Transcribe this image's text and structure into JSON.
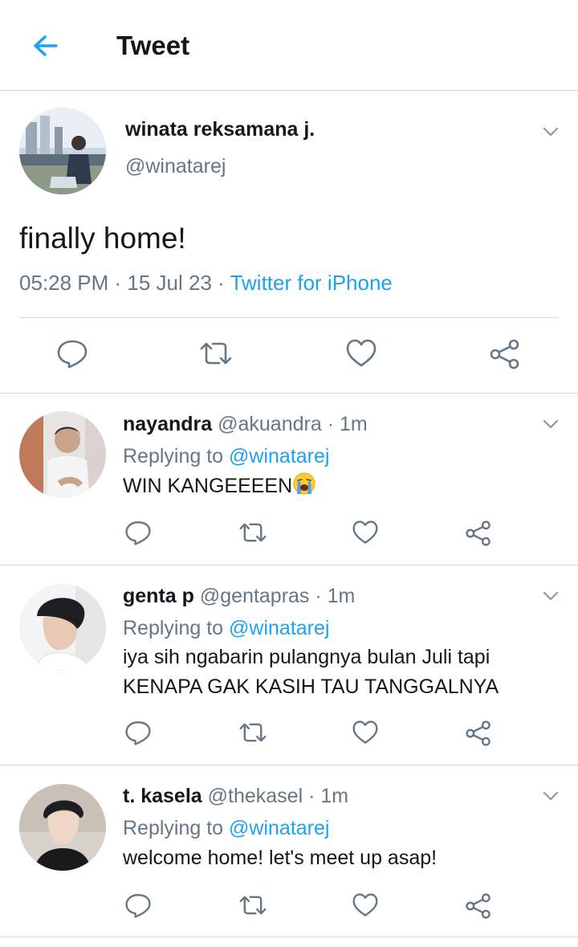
{
  "header": {
    "title": "Tweet",
    "back_icon": "arrow-left-icon",
    "accent": "#1da1f2"
  },
  "tweet": {
    "name": "winata reksamana j.",
    "handle": "@winatarej",
    "text": "finally home!",
    "time": "05:28 PM",
    "sep1": " · ",
    "date": "15 Jul 23",
    "sep2": " · ",
    "source": "Twitter for iPhone"
  },
  "actions": [
    "reply-icon",
    "retweet-icon",
    "like-icon",
    "share-icon"
  ],
  "replies": [
    {
      "name": "nayandra",
      "handle": "@akuandra",
      "time": " · 1m",
      "replying_label": "Replying to ",
      "replying_to": "@winatarej",
      "text": "WIN KANGEEEEN",
      "emoji": "loudly-crying-face-icon"
    },
    {
      "name": "genta p",
      "handle": "@gentapras",
      "time": " · 1m",
      "replying_label": "Replying to ",
      "replying_to": "@winatarej",
      "text_line1": "iya sih ngabarin pulangnya bulan Juli tapi",
      "text_line2": "KENAPA GAK KASIH TAU TANGGALNYA"
    },
    {
      "name": "t. kasela",
      "handle": "@thekasel",
      "time": " · 1m",
      "replying_label": "Replying to ",
      "replying_to": "@winatarej",
      "text": "welcome home! let's meet up asap!"
    }
  ]
}
